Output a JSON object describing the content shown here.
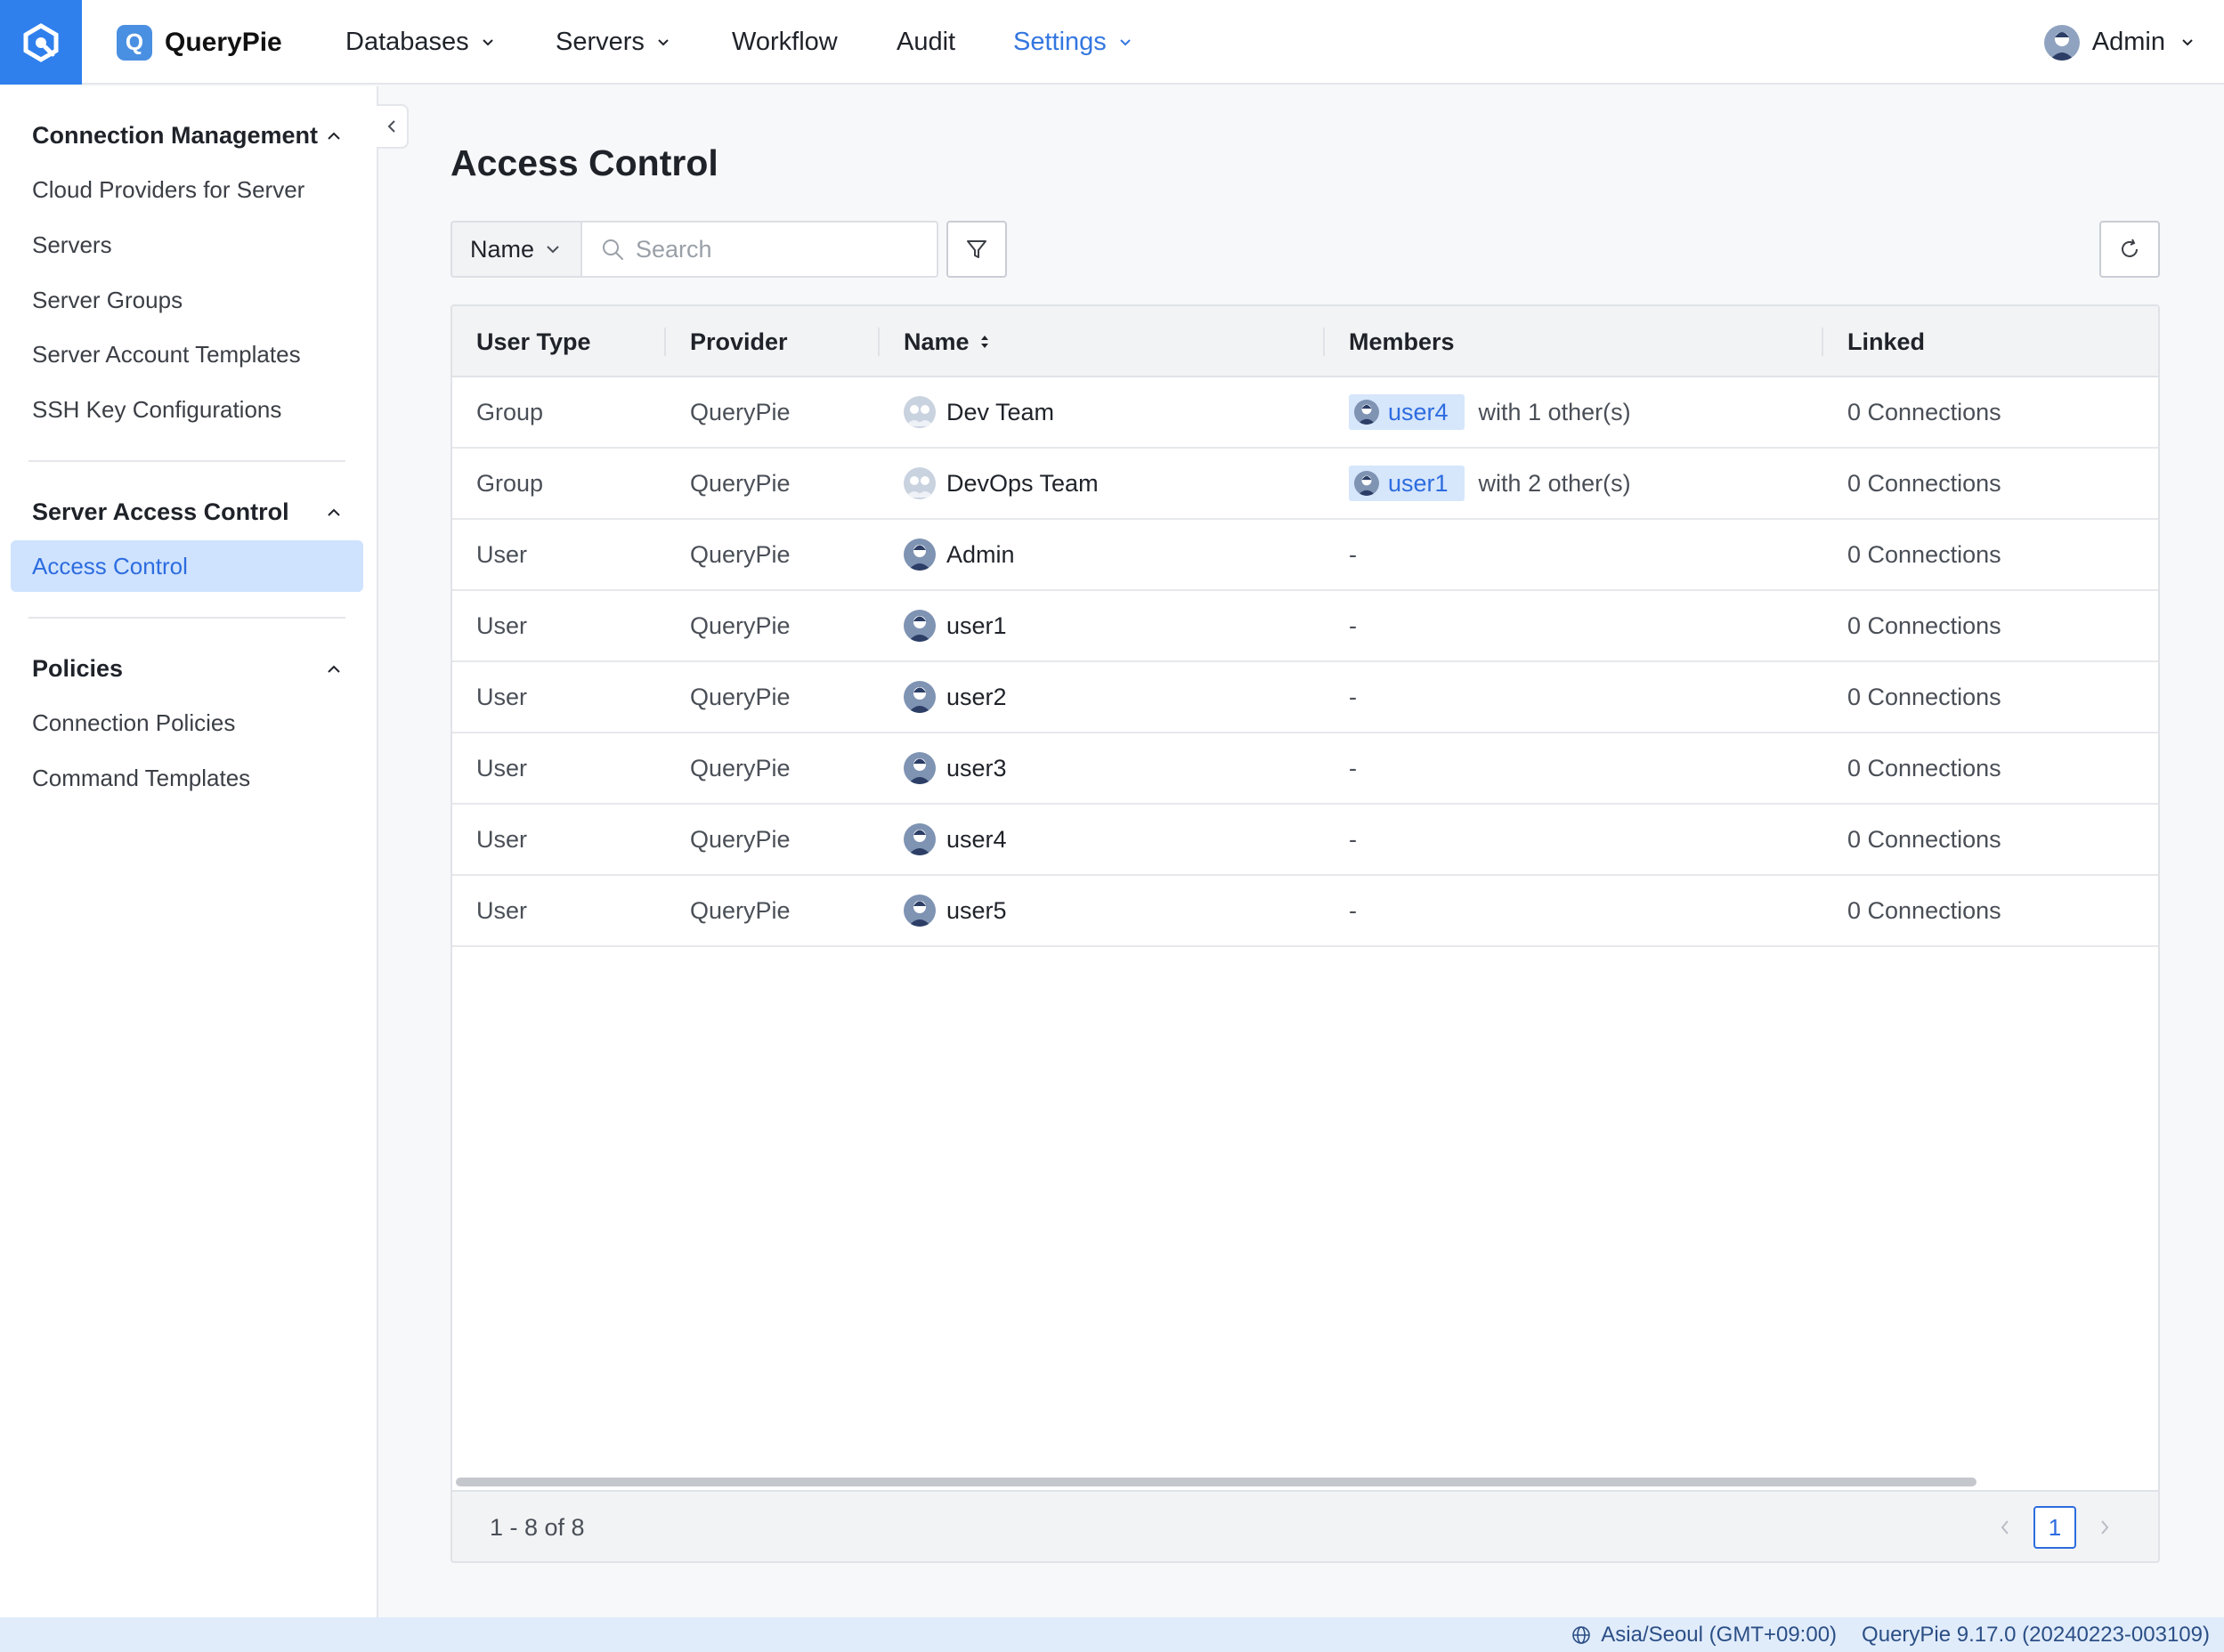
{
  "header": {
    "brand_name": "QueryPie",
    "brand_letter": "Q",
    "nav": {
      "databases": "Databases",
      "servers": "Servers",
      "workflow": "Workflow",
      "audit": "Audit",
      "settings": "Settings"
    },
    "user_name": "Admin"
  },
  "sidebar": {
    "sections": [
      {
        "title": "Connection Management",
        "items": [
          "Cloud Providers for Server",
          "Servers",
          "Server Groups",
          "Server Account Templates",
          "SSH Key Configurations"
        ]
      },
      {
        "title": "Server Access Control",
        "items": [
          "Access Control"
        ]
      },
      {
        "title": "Policies",
        "items": [
          "Connection Policies",
          "Command Templates"
        ]
      }
    ],
    "active_item": "Access Control"
  },
  "main": {
    "title": "Access Control",
    "filter_select": "Name",
    "search_placeholder": "Search",
    "columns": [
      "User Type",
      "Provider",
      "Name",
      "Members",
      "Linked"
    ],
    "rows": [
      {
        "user_type": "Group",
        "provider": "QueryPie",
        "name": "Dev Team",
        "kind": "group",
        "member_tag": "user4",
        "member_more": "with 1 other(s)",
        "members_text": "",
        "linked": "0 Connections"
      },
      {
        "user_type": "Group",
        "provider": "QueryPie",
        "name": "DevOps Team",
        "kind": "group",
        "member_tag": "user1",
        "member_more": "with 2 other(s)",
        "members_text": "",
        "linked": "0 Connections"
      },
      {
        "user_type": "User",
        "provider": "QueryPie",
        "name": "Admin",
        "kind": "user",
        "member_tag": "",
        "member_more": "",
        "members_text": "-",
        "linked": "0 Connections"
      },
      {
        "user_type": "User",
        "provider": "QueryPie",
        "name": "user1",
        "kind": "user",
        "member_tag": "",
        "member_more": "",
        "members_text": "-",
        "linked": "0 Connections"
      },
      {
        "user_type": "User",
        "provider": "QueryPie",
        "name": "user2",
        "kind": "user",
        "member_tag": "",
        "member_more": "",
        "members_text": "-",
        "linked": "0 Connections"
      },
      {
        "user_type": "User",
        "provider": "QueryPie",
        "name": "user3",
        "kind": "user",
        "member_tag": "",
        "member_more": "",
        "members_text": "-",
        "linked": "0 Connections"
      },
      {
        "user_type": "User",
        "provider": "QueryPie",
        "name": "user4",
        "kind": "user",
        "member_tag": "",
        "member_more": "",
        "members_text": "-",
        "linked": "0 Connections"
      },
      {
        "user_type": "User",
        "provider": "QueryPie",
        "name": "user5",
        "kind": "user",
        "member_tag": "",
        "member_more": "",
        "members_text": "-",
        "linked": "0 Connections"
      }
    ],
    "range_text": "1 - 8 of 8",
    "current_page": "1"
  },
  "status": {
    "timezone": "Asia/Seoul (GMT+09:00)",
    "version": "QueryPie 9.17.0 (20240223-003109)"
  },
  "colors": {
    "brand_blue": "#2f80ed",
    "accent": "#2d6cdf",
    "active_bg": "#cfe3ff",
    "tag_bg": "#d6e6fb",
    "status_bg": "#e1ecfb"
  },
  "icons": [
    "querypie-logo-icon",
    "chevron-down-icon",
    "chevron-up-icon",
    "chevron-left-icon",
    "search-icon",
    "filter-icon",
    "refresh-icon",
    "sort-icon",
    "globe-icon",
    "user-avatar-icon",
    "group-avatar-icon"
  ]
}
